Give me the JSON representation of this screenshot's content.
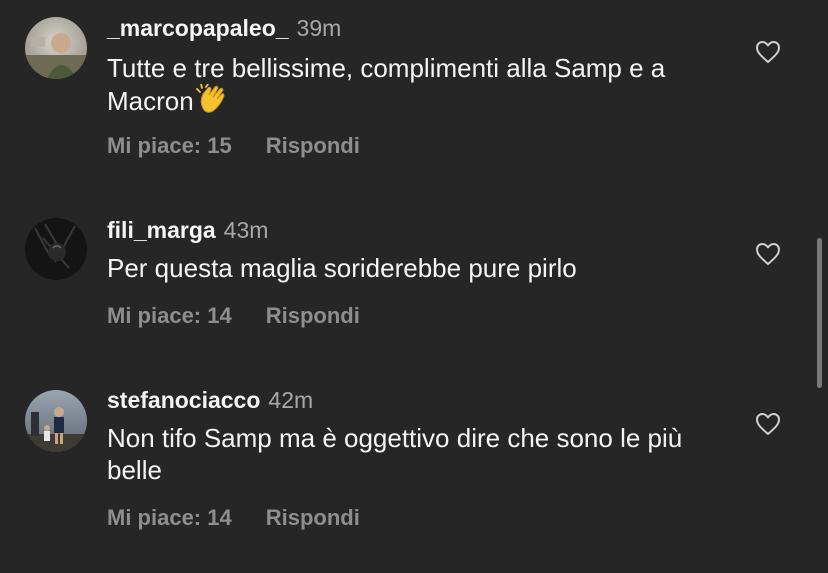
{
  "comments": [
    {
      "username": "_marcopapaleo_",
      "time": "39m",
      "text": "Tutte e tre bellissime, complimenti alla Samp e a Macron",
      "emoji": "clapping-hands",
      "likes": "Mi piace: 15",
      "reply": "Rispondi"
    },
    {
      "username": "fili_marga",
      "time": "43m",
      "text": "Per questa maglia soriderebbe pure pirlo",
      "likes": "Mi piace: 14",
      "reply": "Rispondi"
    },
    {
      "username": "stefanociacco",
      "time": "42m",
      "text": "Non tifo Samp ma è oggettivo dire che sono le più belle",
      "likes": "Mi piace: 14",
      "reply": "Rispondi"
    }
  ],
  "icons": {
    "like": "heart-outline-icon"
  },
  "colors": {
    "background": "#262626",
    "primary_text": "#f5f5f5",
    "secondary_text": "#a8a8a8",
    "action_text": "#8e8e8e"
  }
}
